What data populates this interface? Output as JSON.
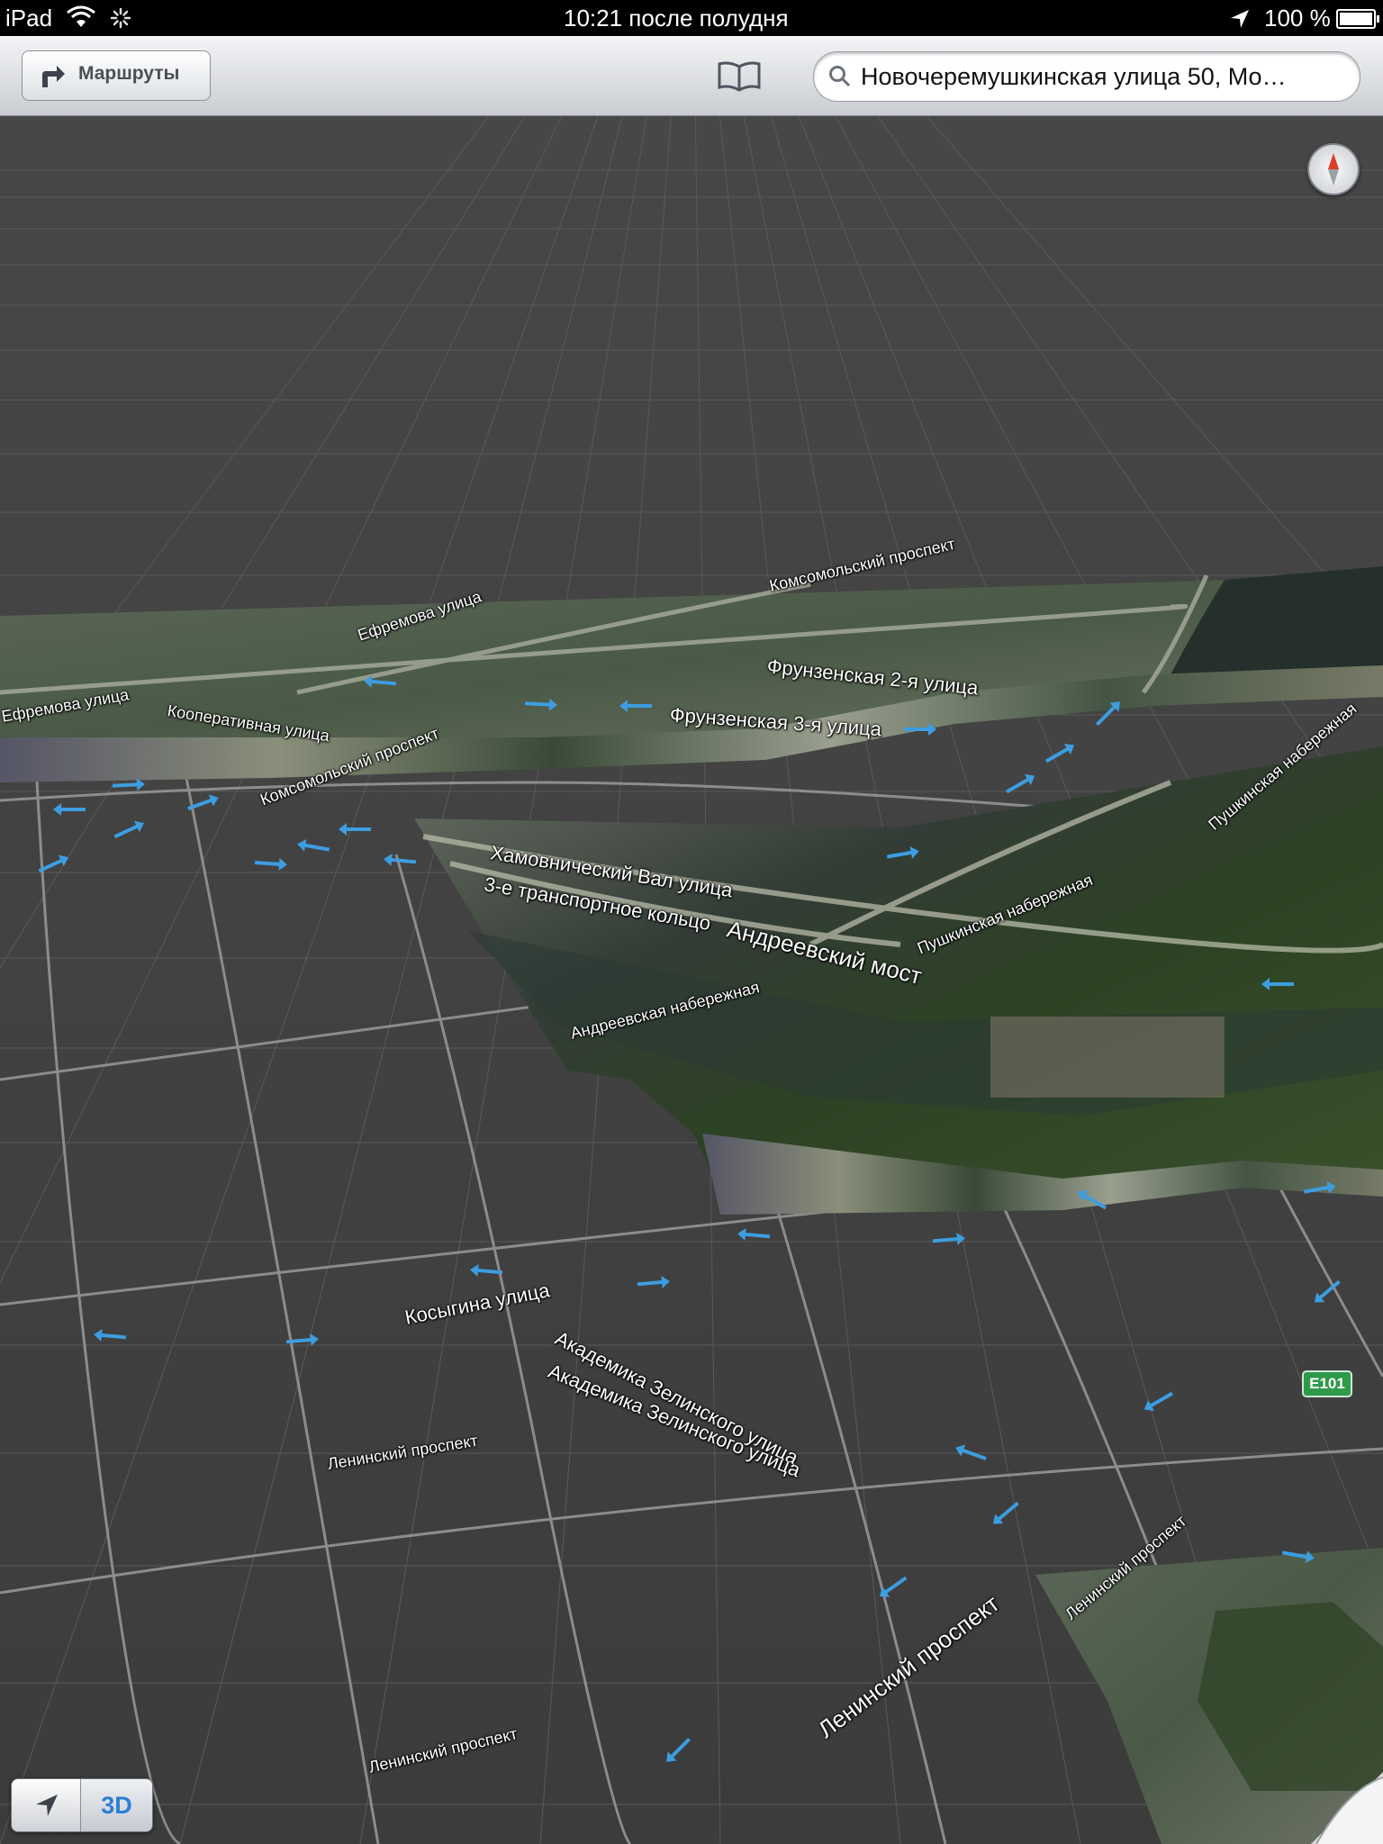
{
  "status_bar": {
    "device": "iPad",
    "time": "10:21 после полудня",
    "battery": "100 %"
  },
  "toolbar": {
    "directions_label": "Маршруты",
    "search_value": "Новочеремушкинская улица 50, Мо…"
  },
  "map": {
    "badge": "E101",
    "mode_3d_label": "3D",
    "labels": {
      "komsomolsky_top": "Комсомольский проспект",
      "efremova_top": "Ефремова улица",
      "frunzenskaya_2": "Фрунзенская 2-я улица",
      "efremova_left": "Ефремова улица",
      "kooperativnaya": "Кооперативная улица",
      "frunzenskaya_3": "Фрунзенская 3-я улица",
      "komsomolsky_bottom": "Комсомольский проспект",
      "pushkinskaya_top": "Пушкинская набережная",
      "khamovnichesky": "Хамовнический Вал улица",
      "ring3": "3-е транспортное кольцо",
      "andreevsky_most": "Андреевский мост",
      "pushkinskaya_mid": "Пушкинская набережная",
      "andreevskaya_nab": "Андреевская набережная",
      "kosygina": "Косыгина улица",
      "zelinskogo_1": "Академика Зелинского улица",
      "zelinskogo_2": "Академика Зелинского улица",
      "leninsky_1": "Ленинский проспект",
      "leninsky_2": "Ленинский проспект",
      "leninsky_3": "Ленинский проспект",
      "leninsky_4": "Ленинский проспект"
    }
  },
  "colors": {
    "accent": "#3d9de0",
    "badge_green": "#2e9a4a",
    "grid_bg": "#3a3a3a"
  },
  "icons": [
    "wifi-icon",
    "activity-spinner-icon",
    "location-arrow-icon",
    "battery-icon",
    "directions-arrow-icon",
    "bookmarks-book-icon",
    "search-icon",
    "compass-icon",
    "locate-me-icon",
    "page-curl-icon"
  ]
}
